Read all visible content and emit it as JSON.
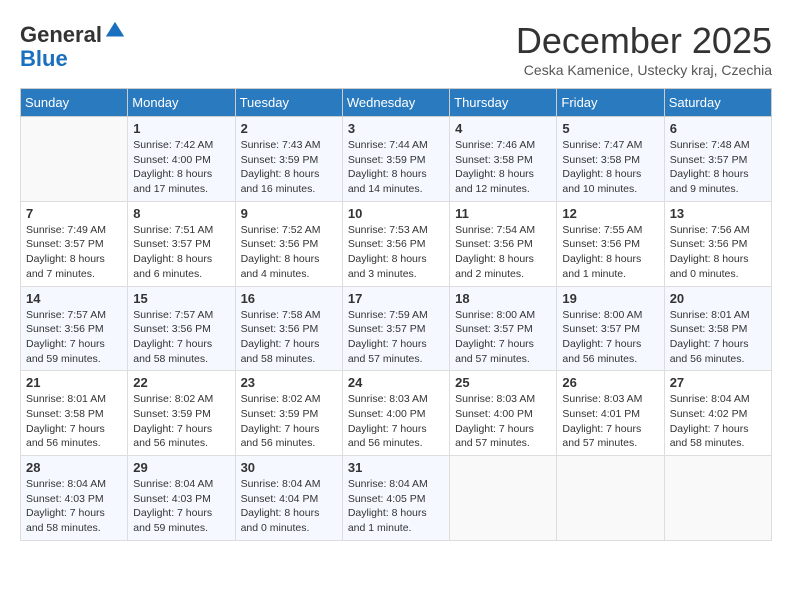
{
  "header": {
    "logo_line1": "General",
    "logo_line2": "Blue",
    "month_title": "December 2025",
    "subtitle": "Ceska Kamenice, Ustecky kraj, Czechia"
  },
  "weekdays": [
    "Sunday",
    "Monday",
    "Tuesday",
    "Wednesday",
    "Thursday",
    "Friday",
    "Saturday"
  ],
  "weeks": [
    [
      {
        "day": "",
        "info": ""
      },
      {
        "day": "1",
        "info": "Sunrise: 7:42 AM\nSunset: 4:00 PM\nDaylight: 8 hours\nand 17 minutes."
      },
      {
        "day": "2",
        "info": "Sunrise: 7:43 AM\nSunset: 3:59 PM\nDaylight: 8 hours\nand 16 minutes."
      },
      {
        "day": "3",
        "info": "Sunrise: 7:44 AM\nSunset: 3:59 PM\nDaylight: 8 hours\nand 14 minutes."
      },
      {
        "day": "4",
        "info": "Sunrise: 7:46 AM\nSunset: 3:58 PM\nDaylight: 8 hours\nand 12 minutes."
      },
      {
        "day": "5",
        "info": "Sunrise: 7:47 AM\nSunset: 3:58 PM\nDaylight: 8 hours\nand 10 minutes."
      },
      {
        "day": "6",
        "info": "Sunrise: 7:48 AM\nSunset: 3:57 PM\nDaylight: 8 hours\nand 9 minutes."
      }
    ],
    [
      {
        "day": "7",
        "info": "Sunrise: 7:49 AM\nSunset: 3:57 PM\nDaylight: 8 hours\nand 7 minutes."
      },
      {
        "day": "8",
        "info": "Sunrise: 7:51 AM\nSunset: 3:57 PM\nDaylight: 8 hours\nand 6 minutes."
      },
      {
        "day": "9",
        "info": "Sunrise: 7:52 AM\nSunset: 3:56 PM\nDaylight: 8 hours\nand 4 minutes."
      },
      {
        "day": "10",
        "info": "Sunrise: 7:53 AM\nSunset: 3:56 PM\nDaylight: 8 hours\nand 3 minutes."
      },
      {
        "day": "11",
        "info": "Sunrise: 7:54 AM\nSunset: 3:56 PM\nDaylight: 8 hours\nand 2 minutes."
      },
      {
        "day": "12",
        "info": "Sunrise: 7:55 AM\nSunset: 3:56 PM\nDaylight: 8 hours\nand 1 minute."
      },
      {
        "day": "13",
        "info": "Sunrise: 7:56 AM\nSunset: 3:56 PM\nDaylight: 8 hours\nand 0 minutes."
      }
    ],
    [
      {
        "day": "14",
        "info": "Sunrise: 7:57 AM\nSunset: 3:56 PM\nDaylight: 7 hours\nand 59 minutes."
      },
      {
        "day": "15",
        "info": "Sunrise: 7:57 AM\nSunset: 3:56 PM\nDaylight: 7 hours\nand 58 minutes."
      },
      {
        "day": "16",
        "info": "Sunrise: 7:58 AM\nSunset: 3:56 PM\nDaylight: 7 hours\nand 58 minutes."
      },
      {
        "day": "17",
        "info": "Sunrise: 7:59 AM\nSunset: 3:57 PM\nDaylight: 7 hours\nand 57 minutes."
      },
      {
        "day": "18",
        "info": "Sunrise: 8:00 AM\nSunset: 3:57 PM\nDaylight: 7 hours\nand 57 minutes."
      },
      {
        "day": "19",
        "info": "Sunrise: 8:00 AM\nSunset: 3:57 PM\nDaylight: 7 hours\nand 56 minutes."
      },
      {
        "day": "20",
        "info": "Sunrise: 8:01 AM\nSunset: 3:58 PM\nDaylight: 7 hours\nand 56 minutes."
      }
    ],
    [
      {
        "day": "21",
        "info": "Sunrise: 8:01 AM\nSunset: 3:58 PM\nDaylight: 7 hours\nand 56 minutes."
      },
      {
        "day": "22",
        "info": "Sunrise: 8:02 AM\nSunset: 3:59 PM\nDaylight: 7 hours\nand 56 minutes."
      },
      {
        "day": "23",
        "info": "Sunrise: 8:02 AM\nSunset: 3:59 PM\nDaylight: 7 hours\nand 56 minutes."
      },
      {
        "day": "24",
        "info": "Sunrise: 8:03 AM\nSunset: 4:00 PM\nDaylight: 7 hours\nand 56 minutes."
      },
      {
        "day": "25",
        "info": "Sunrise: 8:03 AM\nSunset: 4:00 PM\nDaylight: 7 hours\nand 57 minutes."
      },
      {
        "day": "26",
        "info": "Sunrise: 8:03 AM\nSunset: 4:01 PM\nDaylight: 7 hours\nand 57 minutes."
      },
      {
        "day": "27",
        "info": "Sunrise: 8:04 AM\nSunset: 4:02 PM\nDaylight: 7 hours\nand 58 minutes."
      }
    ],
    [
      {
        "day": "28",
        "info": "Sunrise: 8:04 AM\nSunset: 4:03 PM\nDaylight: 7 hours\nand 58 minutes."
      },
      {
        "day": "29",
        "info": "Sunrise: 8:04 AM\nSunset: 4:03 PM\nDaylight: 7 hours\nand 59 minutes."
      },
      {
        "day": "30",
        "info": "Sunrise: 8:04 AM\nSunset: 4:04 PM\nDaylight: 8 hours\nand 0 minutes."
      },
      {
        "day": "31",
        "info": "Sunrise: 8:04 AM\nSunset: 4:05 PM\nDaylight: 8 hours\nand 1 minute."
      },
      {
        "day": "",
        "info": ""
      },
      {
        "day": "",
        "info": ""
      },
      {
        "day": "",
        "info": ""
      }
    ]
  ]
}
